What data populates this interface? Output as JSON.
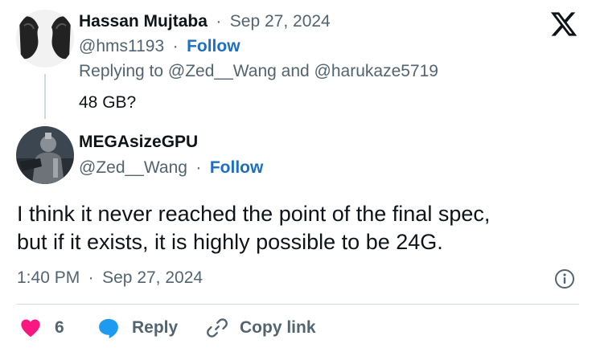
{
  "parent_tweet": {
    "author_name": "Hassan Mujtaba",
    "separator": "·",
    "date": "Sep 27, 2024",
    "handle": "@hms1193",
    "follow_label": "Follow",
    "replying_to": "Replying to @Zed__Wang and @harukaze5719",
    "text": "48 GB?"
  },
  "main_tweet": {
    "author_name": "MEGAsizeGPU",
    "handle": "@Zed__Wang",
    "separator": "·",
    "follow_label": "Follow",
    "text_line1": "I think it never reached the point of the final spec,",
    "text_line2": "but if it exists, it is highly possible to be 24G.",
    "time": "1:40 PM",
    "date": "Sep 27, 2024"
  },
  "actions": {
    "like_count": "6",
    "reply_label": "Reply",
    "copy_link_label": "Copy link"
  },
  "icons": {
    "brand": "x-logo-icon",
    "info": "info-icon",
    "like": "heart-icon",
    "reply": "speech-bubble-icon",
    "copy": "link-icon"
  },
  "colors": {
    "follow": "#1d6fc2",
    "like": "#f91880",
    "reply": "#1d9bf0",
    "muted": "#536471",
    "text": "#0f1419"
  }
}
